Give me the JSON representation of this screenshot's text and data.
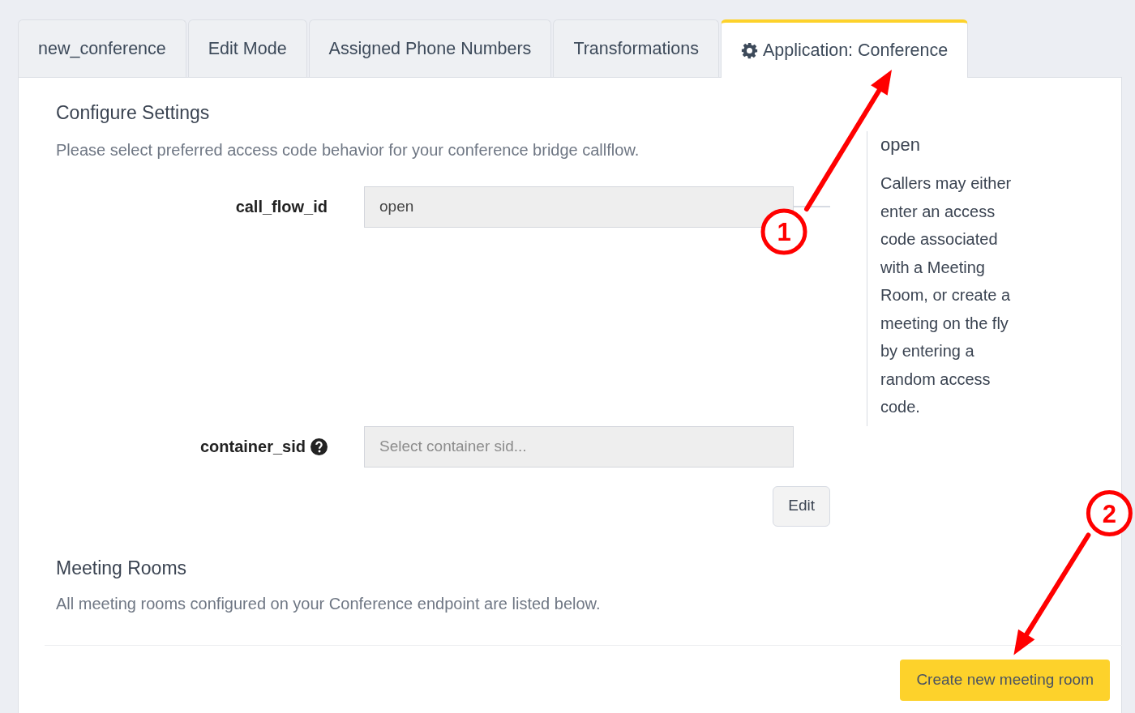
{
  "tabs": [
    {
      "label": "new_conference",
      "selected": false,
      "kind": "plain"
    },
    {
      "label": "Edit Mode",
      "selected": false,
      "kind": "plain"
    },
    {
      "label": "Assigned Phone Numbers",
      "selected": false,
      "kind": "plain"
    },
    {
      "label": "Transformations",
      "selected": false,
      "kind": "plain"
    },
    {
      "label": "Application: Conference",
      "selected": true,
      "kind": "application"
    }
  ],
  "settings": {
    "title": "Configure Settings",
    "description": "Please select preferred access code behavior for your conference bridge callflow.",
    "fields": [
      {
        "label": "call_flow_id",
        "value": "open",
        "help_icon": false
      },
      {
        "label": "container_sid",
        "placeholder": "Select container sid...",
        "help_icon": true
      }
    ],
    "edit_button": "Edit"
  },
  "help_panel": {
    "title": "open",
    "text": "Callers may either enter an access code associated with a Meeting Room, or create a meeting on the fly by entering a random access code."
  },
  "meeting_rooms": {
    "title": "Meeting Rooms",
    "description": "All meeting rooms configured on your Conference endpoint are listed below.",
    "create_button": "Create new meeting room"
  },
  "annotations": [
    {
      "label": "1"
    },
    {
      "label": "2"
    }
  ]
}
